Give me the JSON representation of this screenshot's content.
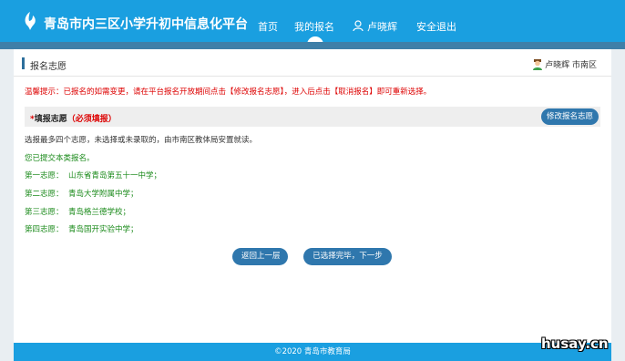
{
  "header": {
    "site_title": "青岛市内三区小学升初中信息化平台",
    "nav": {
      "home": "首页",
      "my_registration": "我的报名",
      "user_name": "卢晓辉",
      "logout": "安全退出"
    }
  },
  "panel": {
    "title": "报名志愿",
    "user": "卢晓辉 市南区"
  },
  "tip": "温馨提示：已报名的如需变更，请在平台报名开放期间点击【修改报名志愿】，进入后点击【取消报名】即可重新选择。",
  "section": {
    "star": "*",
    "title": "填报志愿",
    "required": "（必须填报）",
    "modify_button": "修改报名志愿"
  },
  "description": "选报最多四个志愿，未选择或未录取的，由市南区教体局安置就读。",
  "status": "您已提交本类报名。",
  "choices": [
    {
      "label": "第一志愿：",
      "school": "山东省青岛第五十一中学；"
    },
    {
      "label": "第二志愿：",
      "school": "青岛大学附属中学；"
    },
    {
      "label": "第三志愿：",
      "school": "青岛格兰德学校；"
    },
    {
      "label": "第四志愿：",
      "school": "青岛国开实验中学；"
    }
  ],
  "buttons": {
    "back": "返回上一层",
    "next": "已选择完毕，下一步"
  },
  "footer": "©2020 青岛市教育局",
  "watermark": "husay.cn",
  "colors": {
    "header_blue": "#1a9fe0",
    "button_blue": "#2f77ad",
    "tip_red": "#dd0000",
    "choice_green": "#1a8a1a"
  }
}
